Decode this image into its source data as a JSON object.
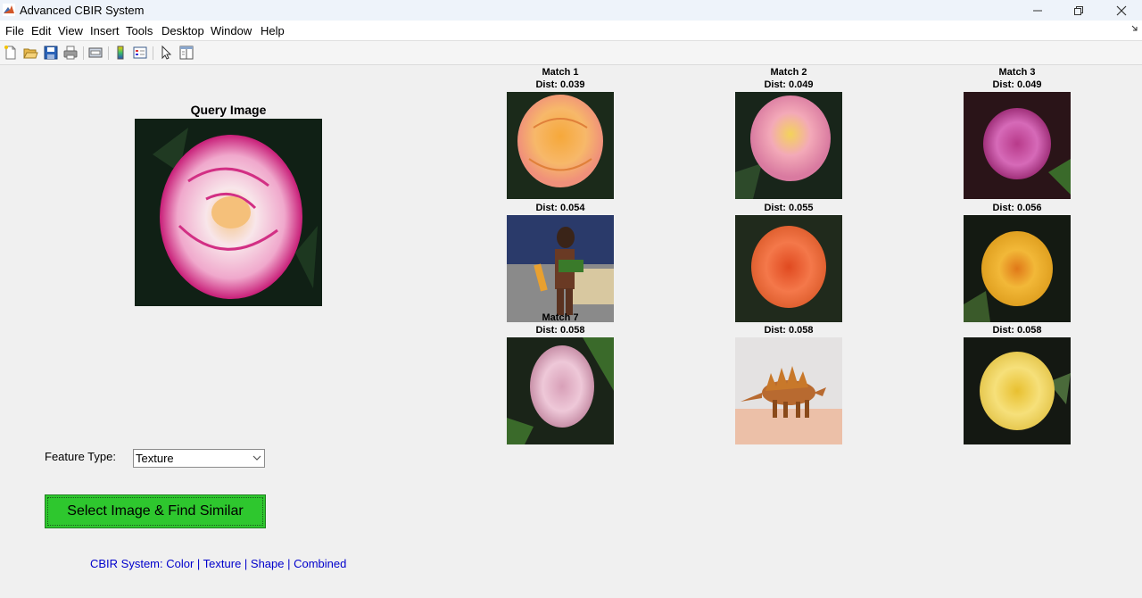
{
  "window": {
    "title": "Advanced CBIR System"
  },
  "menu": [
    "File",
    "Edit",
    "View",
    "Insert",
    "Tools",
    "Desktop",
    "Window",
    "Help"
  ],
  "toolbar": [
    "new-figure",
    "open-file",
    "save",
    "print",
    "print-preview",
    "colorbar",
    "legend",
    "edit-plot",
    "property-inspector"
  ],
  "query": {
    "title": "Query Image",
    "subject": "pink-white rose"
  },
  "matches": [
    {
      "title": "Match 1",
      "dist": "Dist: 0.039",
      "subject": "peach rose"
    },
    {
      "title": "Match 2",
      "dist": "Dist: 0.049",
      "subject": "pink-yellow rose"
    },
    {
      "title": "Match 3",
      "dist": "Dist: 0.049",
      "subject": "magenta rose"
    },
    {
      "title": "",
      "dist": "Dist: 0.054",
      "subject": "person with bundle"
    },
    {
      "title": "",
      "dist": "Dist: 0.055",
      "subject": "orange rose"
    },
    {
      "title": "",
      "dist": "Dist: 0.056",
      "subject": "golden rose"
    },
    {
      "title": "Match 7",
      "dist": "Dist: 0.058",
      "subject": "pale pink rose"
    },
    {
      "title": "",
      "dist": "Dist: 0.058",
      "subject": "stegosaurus model"
    },
    {
      "title": "",
      "dist": "Dist: 0.058",
      "subject": "yellow rose"
    }
  ],
  "controls": {
    "feature_label": "Feature Type:",
    "feature_value": "Texture",
    "find_button": "Select Image & Find Similar"
  },
  "footer": "CBIR System: Color | Texture | Shape | Combined"
}
